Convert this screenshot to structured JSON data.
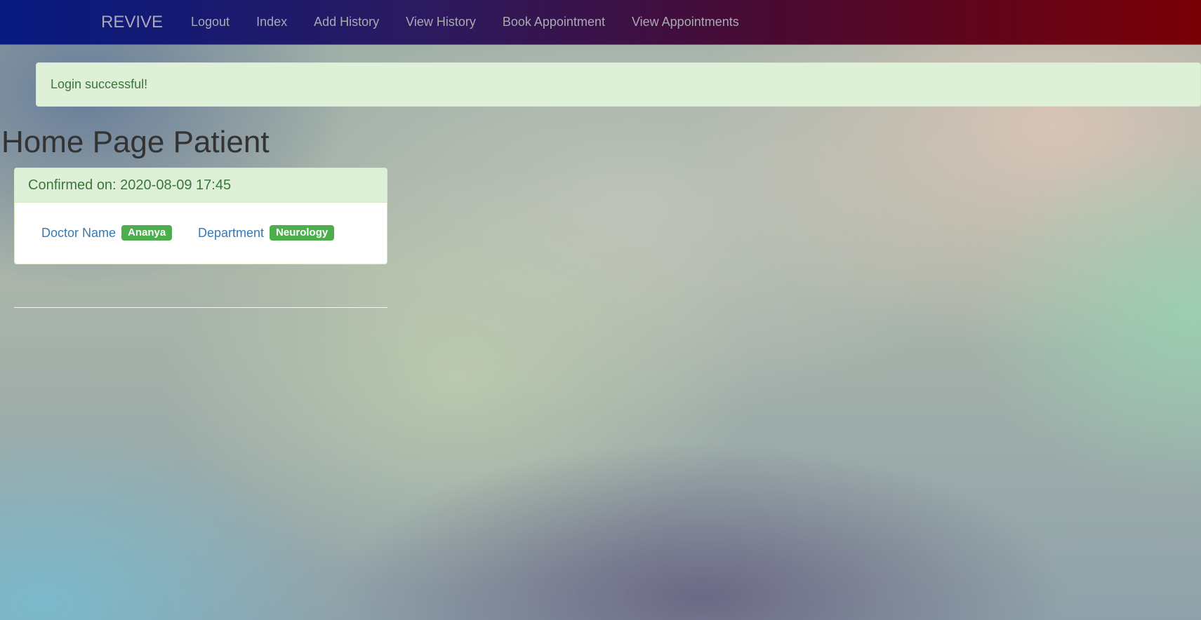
{
  "navbar": {
    "brand": "REVIVE",
    "items": [
      {
        "label": "Logout"
      },
      {
        "label": "Index"
      },
      {
        "label": "Add History"
      },
      {
        "label": "View History"
      },
      {
        "label": "Book Appointment"
      },
      {
        "label": "View Appointments"
      }
    ]
  },
  "alert": {
    "message": "Login successful!"
  },
  "main": {
    "title": "Home Page Patient",
    "appointment": {
      "heading": "Confirmed on: 2020-08-09 17:45",
      "doctor_label": "Doctor Name",
      "doctor_value": "Ananya",
      "department_label": "Department",
      "department_value": "Neurology"
    }
  },
  "colors": {
    "navbar_start": "#071a80",
    "navbar_end": "#7a0006",
    "alert_bg": "#dff0d8",
    "alert_text": "#3c763d",
    "badge": "#4cae4c",
    "link": "#337ab7"
  }
}
